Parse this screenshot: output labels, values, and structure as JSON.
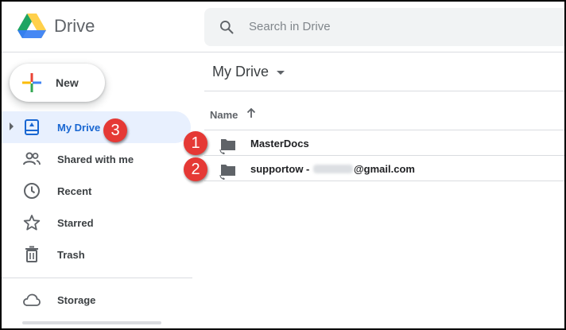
{
  "app": {
    "brand": "Drive",
    "logo_icon": "google-drive-logo",
    "colors": {
      "green": "#1fa463",
      "yellow": "#ffd04b",
      "blue": "#4688f4",
      "accent": "#1967d2",
      "badge": "#e53935"
    }
  },
  "search": {
    "placeholder": "Search in Drive",
    "icon": "search-icon"
  },
  "sidebar": {
    "new_button": {
      "label": "New",
      "icon": "plus-icon"
    },
    "items": [
      {
        "label": "My Drive",
        "icon": "my-drive-icon",
        "active": true
      },
      {
        "label": "Shared with me",
        "icon": "people-icon",
        "active": false
      },
      {
        "label": "Recent",
        "icon": "clock-icon",
        "active": false
      },
      {
        "label": "Starred",
        "icon": "star-icon",
        "active": false
      },
      {
        "label": "Trash",
        "icon": "trash-icon",
        "active": false
      },
      {
        "label": "Storage",
        "icon": "cloud-icon",
        "active": false
      }
    ]
  },
  "main": {
    "title": "My Drive",
    "column_name": "Name",
    "sort_icon": "arrow-up-icon",
    "rows": [
      {
        "name": "MasterDocs",
        "icon": "shared-folder-icon"
      },
      {
        "name_prefix": "supportow - ",
        "name_suffix": "@gmail.com",
        "icon": "shared-folder-icon"
      }
    ]
  },
  "annotations": {
    "badge1": "1",
    "badge2": "2",
    "badge3": "3"
  }
}
